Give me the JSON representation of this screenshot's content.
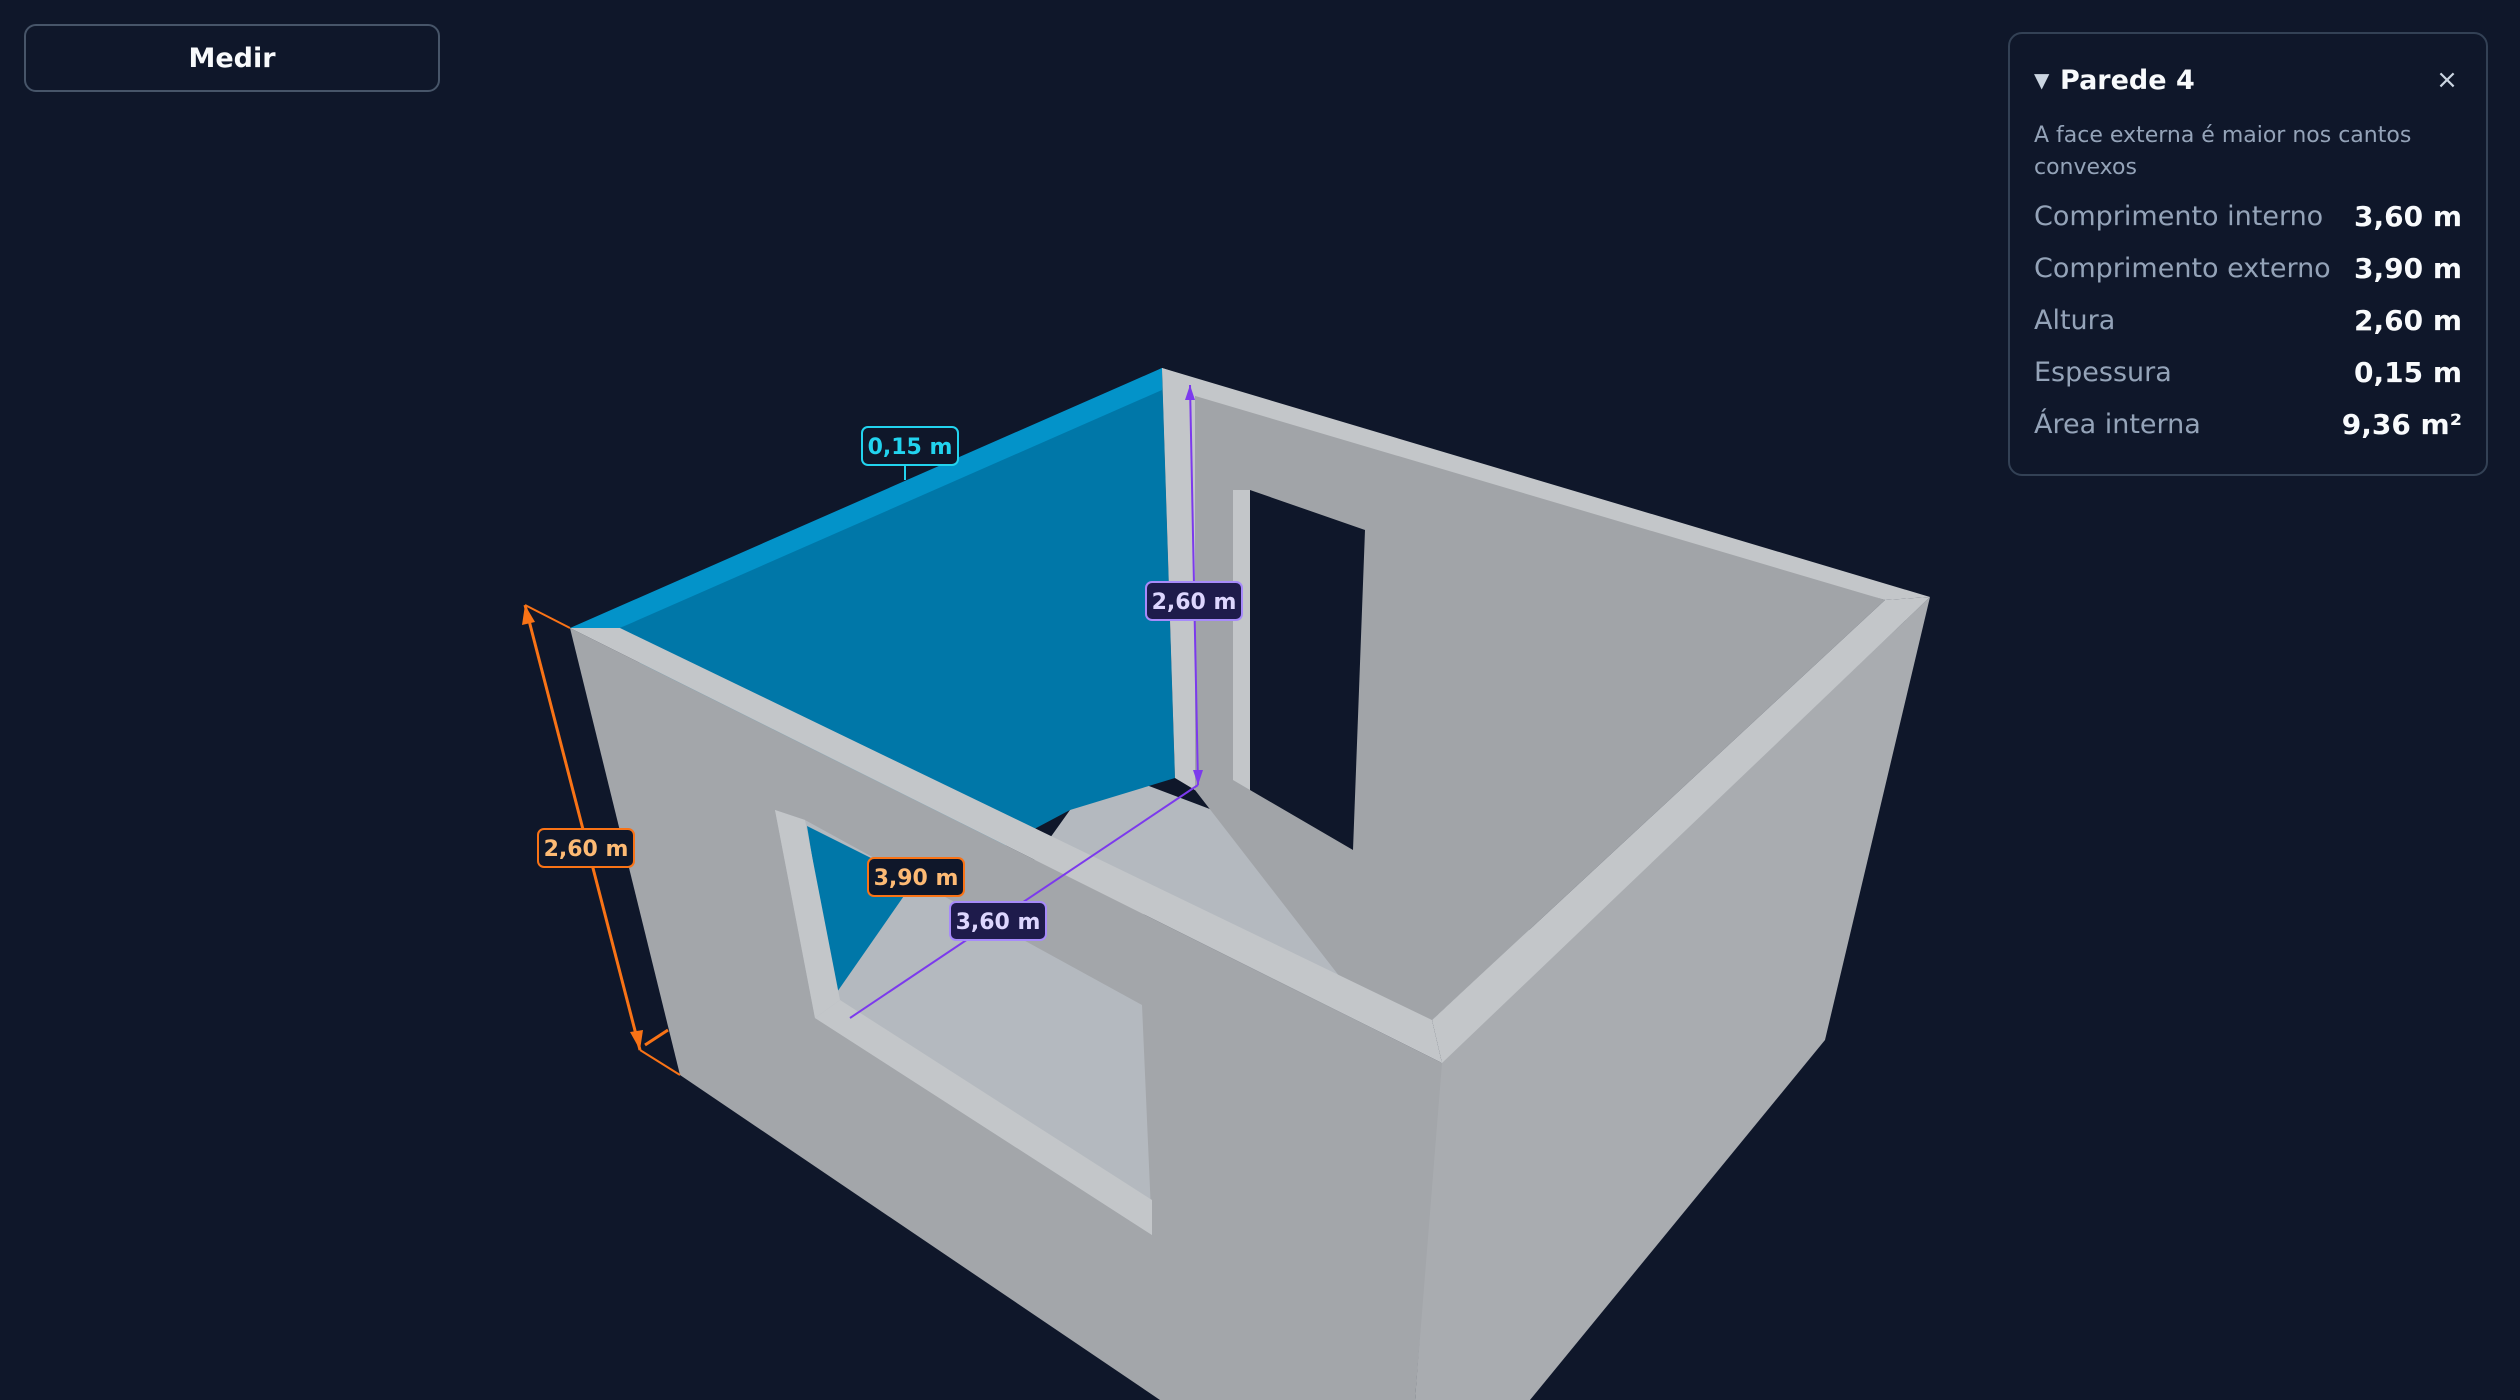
{
  "toolbar": {
    "measure_label": "Medir"
  },
  "panel": {
    "title": "Parede 4",
    "toggle_icon": "▼",
    "close_icon": "×",
    "note": "A face externa é maior nos cantos convexos",
    "properties": [
      {
        "label": "Comprimento interno",
        "value": "3,60 m"
      },
      {
        "label": "Comprimento externo",
        "value": "3,90 m"
      },
      {
        "label": "Altura",
        "value": "2,60 m"
      },
      {
        "label": "Espessura",
        "value": "0,15 m"
      },
      {
        "label": "Área interna",
        "value": "9,36 m²"
      }
    ]
  },
  "scene": {
    "thickness_label": "0,15 m",
    "inner_height_label": "2,60 m",
    "outer_height_label": "2,60 m",
    "outer_length_label": "3,90 m",
    "inner_length_label": "3,60 m"
  },
  "colors": {
    "background": "#0f172a",
    "selected_wall": "#0077a8",
    "selected_wall_top": "#0393c9",
    "wall_face": "#a1a4a8",
    "wall_top": "#c3c6c9",
    "floor": "#b4b9bf",
    "inner_dimension": "#7c3aed",
    "outer_dimension": "#f97316",
    "thickness_dimension": "#22d3ee"
  }
}
